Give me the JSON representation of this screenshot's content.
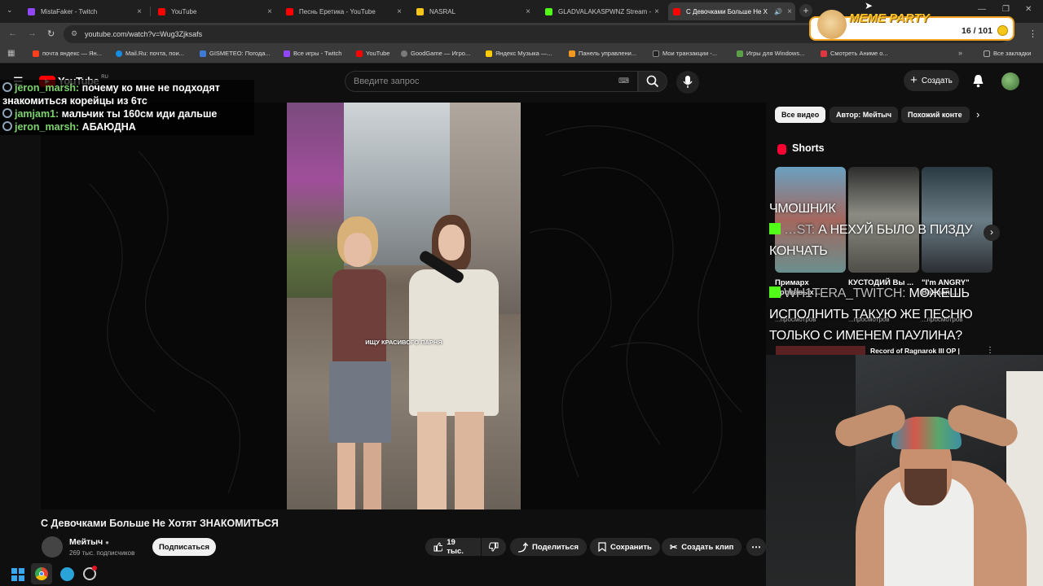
{
  "tabs": [
    {
      "title": "MistaFaker - Twitch",
      "favicon_color": "#9146ff"
    },
    {
      "title": "YouTube",
      "favicon_color": "#ff0000"
    },
    {
      "title": "Песнь Еретика - YouTube",
      "favicon_color": "#ff0000"
    },
    {
      "title": "NASRAL",
      "favicon_color": "#f5c518"
    },
    {
      "title": "GLADVALAKASPWNZ Stream -",
      "favicon_color": "#53fc18"
    },
    {
      "title": "С Девочками Больше Не Х",
      "favicon_color": "#ff0000"
    }
  ],
  "address": {
    "url": "youtube.com/watch?v=Wug3Zjksafs"
  },
  "bookmarks": [
    {
      "label": "почта яндекс — Ян...",
      "color": "#fc3f1d"
    },
    {
      "label": "Mail.Ru: почта, пои...",
      "color": "#168de2"
    },
    {
      "label": "GISMETEO: Погода...",
      "color": "#3d7bd6"
    },
    {
      "label": "Все игры - Twitch",
      "color": "#9146ff"
    },
    {
      "label": "YouTube",
      "color": "#ff0000"
    },
    {
      "label": "GoodGame — Игро...",
      "color": "#7a7a7a"
    },
    {
      "label": "Яндекс Музыка —...",
      "color": "#ffcc00"
    },
    {
      "label": "Панель управлени...",
      "color": "#f29a1f"
    },
    {
      "label": "Мои транзакции -...",
      "color": "#222222"
    },
    {
      "label": "Игры для Windows...",
      "color": "#5aa14a"
    },
    {
      "label": "Смотреть Аниме о...",
      "color": "#e0383e"
    },
    {
      "label": "Все закладки",
      "color": "#999999"
    }
  ],
  "youtube": {
    "logo": "YouTube",
    "region": "RU",
    "search_placeholder": "Введите запрос",
    "create_label": "Создать"
  },
  "chat": [
    {
      "nick": "jeron_marsh",
      "text": "почему ко мне не подходят знакомиться корейцы из 6тс"
    },
    {
      "nick": "jamjam1",
      "text": "мальчик ты 160см иди дальше"
    },
    {
      "nick": "jeron_marsh",
      "text": "АБАЮДНА"
    }
  ],
  "video": {
    "caption": "ИЩУ КРАСИВОГО ПАРНЯ",
    "title": "С Девочками Больше Не Хотят ЗНАКОМИТЬСЯ",
    "channel": "Мейтыч",
    "subscribers": "269 тыс. подписчиков",
    "subscribe_label": "Подписаться",
    "likes": "19 тыс.",
    "share_label": "Поделиться",
    "save_label": "Сохранить",
    "clip_label": "Создать клип"
  },
  "chips": [
    "Все видео",
    "Автор: Мейтыч",
    "Похожий конте"
  ],
  "shorts": {
    "heading": "Shorts",
    "items": [
      {
        "title": "Примарх Кровавых ...",
        "views": "...просмотров"
      },
      {
        "title": "КУСТОДИЙ Вы ...",
        "views": "...просмотров"
      },
      {
        "title": "\"I'm ANGRY\" Batman ...",
        "views": "...просмотров"
      }
    ],
    "next_title": "Record of Ragnarok III OP |"
  },
  "alerts": {
    "first": "ЧМОШНИК",
    "first_nick": "…ST:",
    "first_text": "А НЕХУЙ БЫЛО В ПИЗДУ КОНЧАТЬ",
    "second_nick": "WH1TERA_TWITCH:",
    "second_text": "МОЖЕШЬ ИСПОЛНИТЬ ТАКУЮ ЖЕ ПЕСНЮ ТОЛЬКО С ИМЕНЕМ ПАУЛИНА?"
  },
  "meme_party": {
    "title": "MEME PARTY",
    "count": "16 / 101"
  }
}
